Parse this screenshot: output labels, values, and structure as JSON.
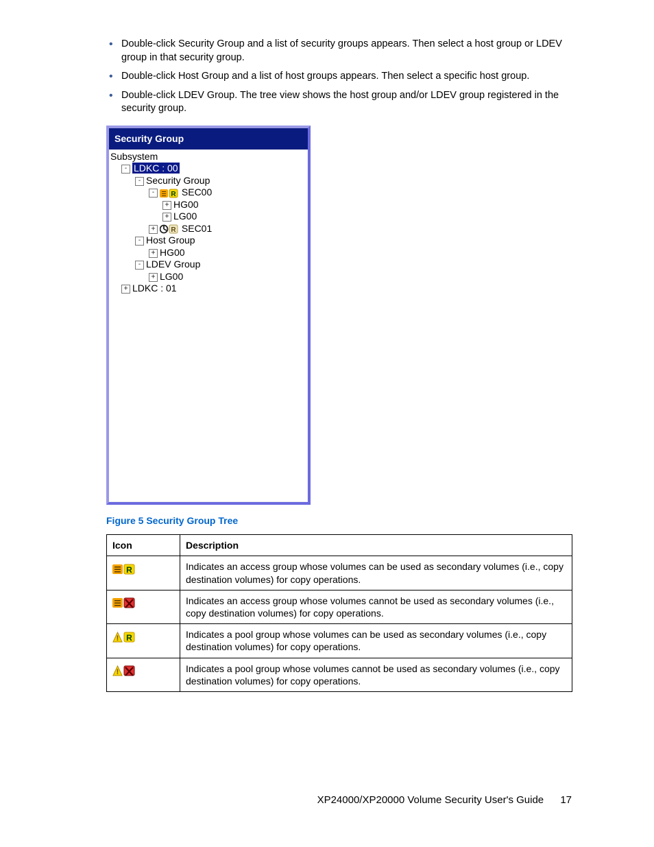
{
  "bullets": [
    "Double-click Security Group and a list of security groups appears. Then select a host group or LDEV group in that security group.",
    "Double-click Host Group and a list of host groups appears. Then select a specific host group.",
    "Double-click LDEV Group. The tree view shows the host group and/or LDEV group registered in the security group."
  ],
  "panel": {
    "title": "Security Group",
    "tree": {
      "root": "Subsystem",
      "n1": "LDKC : 00",
      "n2": "Security Group",
      "n3a": "SEC00",
      "n4a": "HG00",
      "n4b": "LG00",
      "n3b": "SEC01",
      "n5": "Host Group",
      "n5a": "HG00",
      "n6": "LDEV Group",
      "n6a": "LG00",
      "n7": "LDKC : 01"
    }
  },
  "figure_caption": "Figure 5 Security Group Tree",
  "table": {
    "headers": {
      "icon": "Icon",
      "desc": "Description"
    },
    "rows": [
      {
        "icon": "access-can",
        "desc": "Indicates an access group whose volumes can be used as secondary volumes (i.e., copy destination volumes) for copy operations."
      },
      {
        "icon": "access-cannot",
        "desc": "Indicates an access group whose volumes cannot be used as secondary volumes (i.e., copy destination volumes) for copy operations."
      },
      {
        "icon": "pool-can",
        "desc": "Indicates a pool group whose volumes can be used as secondary volumes (i.e., copy destination volumes) for copy operations."
      },
      {
        "icon": "pool-cannot",
        "desc": "Indicates a pool group whose volumes cannot be used as secondary volumes (i.e., copy destination volumes) for copy operations."
      }
    ]
  },
  "footer": {
    "title": "XP24000/XP20000 Volume Security User's Guide",
    "page": "17"
  }
}
